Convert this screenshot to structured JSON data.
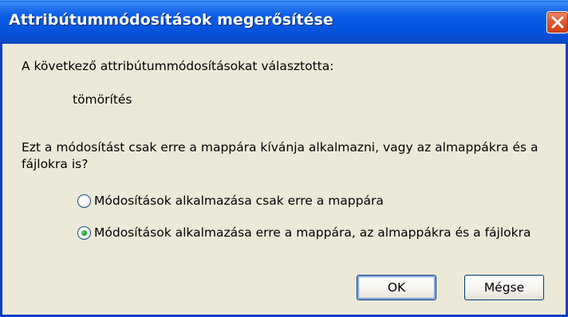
{
  "window": {
    "title": "Attribútummódosítások megerősítése"
  },
  "content": {
    "intro": "A következő attribútummódosításokat választotta:",
    "change_name": "tömörítés",
    "question_line1": "Ezt a módosítást csak erre a mappára kívánja alkalmazni, vagy az almappákra és a",
    "question_line2": "fájlokra is?"
  },
  "options": [
    {
      "label": "Módosítások alkalmazása csak erre a mappára",
      "selected": false
    },
    {
      "label": "Módosítások alkalmazása erre a mappára, az almappákra és a fájlokra",
      "selected": true
    }
  ],
  "buttons": {
    "ok": "OK",
    "cancel": "Mégse"
  },
  "colors": {
    "titlebar": "#0550d7",
    "dialog_bg": "#ece9d8",
    "close_button": "#e05a2f",
    "radio_selected": "#21a12c"
  },
  "icons": {
    "close": "close-icon"
  }
}
